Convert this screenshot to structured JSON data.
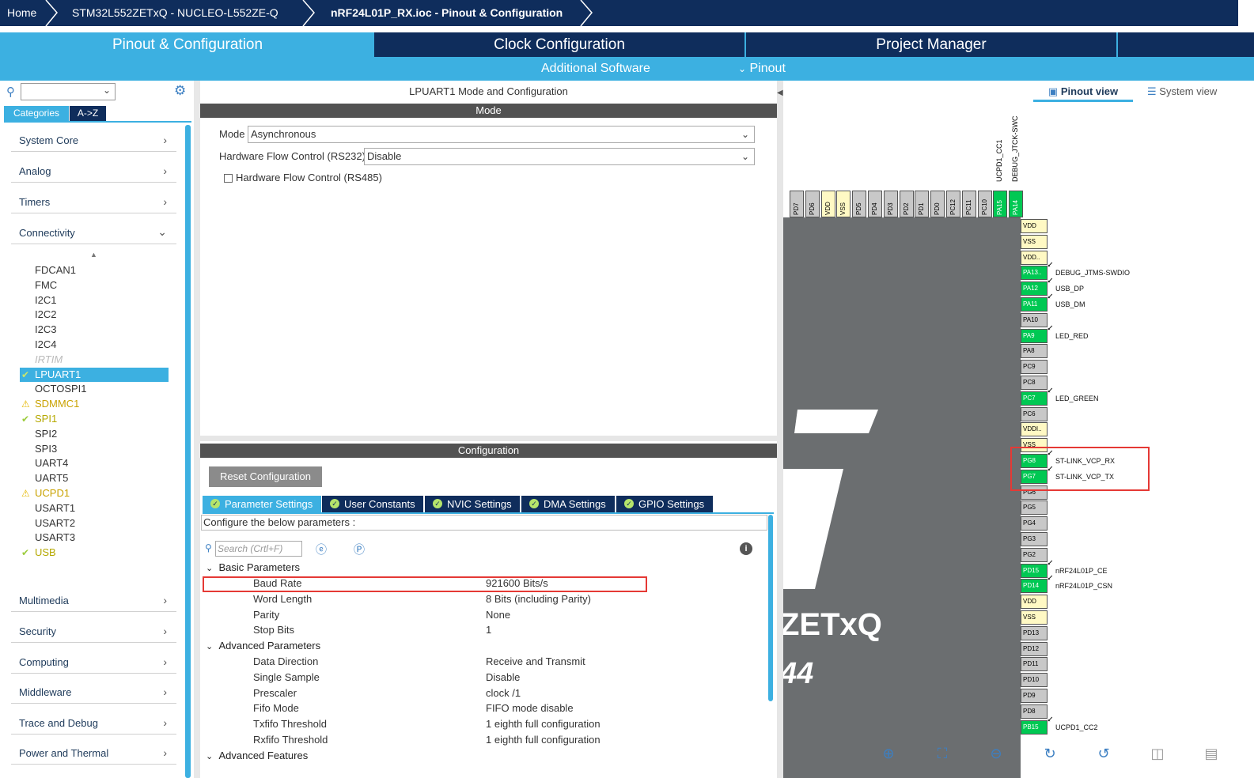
{
  "breadcrumb": {
    "home": "Home",
    "board": "STM32L552ZETxQ  -  NUCLEO-L552ZE-Q",
    "file": "nRF24L01P_RX.ioc - Pinout & Configuration"
  },
  "tabs": {
    "pinout": "Pinout & Configuration",
    "clock": "Clock Configuration",
    "project": "Project Manager",
    "additional": "Additional Software",
    "pinout_menu": "Pinout"
  },
  "sidebar": {
    "search_value": "",
    "tab_categories": "Categories",
    "tab_az": "A->Z",
    "categories": [
      "System Core",
      "Analog",
      "Timers",
      "Connectivity"
    ],
    "connectivity_items": [
      {
        "label": "FDCAN1",
        "mark": ""
      },
      {
        "label": "FMC",
        "mark": ""
      },
      {
        "label": "I2C1",
        "mark": ""
      },
      {
        "label": "I2C2",
        "mark": ""
      },
      {
        "label": "I2C3",
        "mark": ""
      },
      {
        "label": "I2C4",
        "mark": ""
      },
      {
        "label": "IRTIM",
        "mark": "disabled"
      },
      {
        "label": "LPUART1",
        "mark": "check-selected"
      },
      {
        "label": "OCTOSPI1",
        "mark": ""
      },
      {
        "label": "SDMMC1",
        "mark": "warning"
      },
      {
        "label": "SPI1",
        "mark": "check"
      },
      {
        "label": "SPI2",
        "mark": ""
      },
      {
        "label": "SPI3",
        "mark": ""
      },
      {
        "label": "UART4",
        "mark": ""
      },
      {
        "label": "UART5",
        "mark": ""
      },
      {
        "label": "UCPD1",
        "mark": "warning"
      },
      {
        "label": "USART1",
        "mark": ""
      },
      {
        "label": "USART2",
        "mark": ""
      },
      {
        "label": "USART3",
        "mark": ""
      },
      {
        "label": "USB",
        "mark": "check"
      }
    ],
    "lower_categories": [
      "Multimedia",
      "Security",
      "Computing",
      "Middleware",
      "Trace and Debug",
      "Power and Thermal"
    ]
  },
  "mode_panel": {
    "title": "LPUART1 Mode and Configuration",
    "section": "Mode",
    "mode_label": "Mode",
    "mode_value": "Asynchronous",
    "hwfc_label": "Hardware Flow Control (RS232)",
    "hwfc_value": "Disable",
    "rs485_label": "Hardware Flow Control (RS485)"
  },
  "config_panel": {
    "section": "Configuration",
    "reset_button": "Reset Configuration",
    "tabs": [
      "Parameter Settings",
      "User Constants",
      "NVIC Settings",
      "DMA Settings",
      "GPIO Settings"
    ],
    "hint": "Configure the below parameters :",
    "search_placeholder": "Search (Crtl+F)",
    "groups": {
      "basic": "Basic Parameters",
      "advanced": "Advanced Parameters",
      "features": "Advanced Features"
    },
    "basic_params": [
      {
        "name": "Baud Rate",
        "value": "921600 Bits/s"
      },
      {
        "name": "Word Length",
        "value": "8 Bits (including Parity)"
      },
      {
        "name": "Parity",
        "value": "None"
      },
      {
        "name": "Stop Bits",
        "value": "1"
      }
    ],
    "advanced_params": [
      {
        "name": "Data Direction",
        "value": "Receive and Transmit"
      },
      {
        "name": "Single Sample",
        "value": "Disable"
      },
      {
        "name": "Prescaler",
        "value": "clock /1"
      },
      {
        "name": "Fifo Mode",
        "value": "FIFO mode disable"
      },
      {
        "name": "Txfifo Threshold",
        "value": "1 eighth full configuration"
      },
      {
        "name": "Rxfifo Threshold",
        "value": "1 eighth full configuration"
      }
    ]
  },
  "pinout": {
    "pinout_view": "Pinout view",
    "system_view": "System view",
    "chip_text": "ZETxQ",
    "chip_pkg": "44",
    "top_pins": [
      "PD7",
      "PD6",
      "VDD",
      "VSS",
      "PD5",
      "PD4",
      "PD3",
      "PD2",
      "PD1",
      "PD0",
      "PC12",
      "PC11",
      "PC10",
      "PA15",
      "PA14"
    ],
    "top_signals": [
      "UCPD1_CC1",
      "DEBUG_JTCK-SWC"
    ],
    "right_pins": [
      {
        "pin": "VDD",
        "type": "y",
        "signal": ""
      },
      {
        "pin": "VSS",
        "type": "y",
        "signal": ""
      },
      {
        "pin": "VDD..",
        "type": "y",
        "signal": ""
      },
      {
        "pin": "PA13..",
        "type": "g",
        "signal": "DEBUG_JTMS-SWDIO"
      },
      {
        "pin": "PA12",
        "type": "g",
        "signal": "USB_DP"
      },
      {
        "pin": "PA11",
        "type": "g",
        "signal": "USB_DM"
      },
      {
        "pin": "PA10",
        "type": "",
        "signal": ""
      },
      {
        "pin": "PA9",
        "type": "g",
        "signal": "LED_RED"
      },
      {
        "pin": "PA8",
        "type": "",
        "signal": ""
      },
      {
        "pin": "PC9",
        "type": "",
        "signal": ""
      },
      {
        "pin": "PC8",
        "type": "",
        "signal": ""
      },
      {
        "pin": "PC7",
        "type": "g",
        "signal": "LED_GREEN"
      },
      {
        "pin": "PC6",
        "type": "",
        "signal": ""
      },
      {
        "pin": "VDDI..",
        "type": "y",
        "signal": ""
      },
      {
        "pin": "VSS",
        "type": "y",
        "signal": ""
      },
      {
        "pin": "PG8",
        "type": "g",
        "signal": "ST-LINK_VCP_RX"
      },
      {
        "pin": "PG7",
        "type": "g",
        "signal": "ST-LINK_VCP_TX"
      },
      {
        "pin": "PG6",
        "type": "",
        "signal": ""
      },
      {
        "pin": "PG5",
        "type": "",
        "signal": ""
      },
      {
        "pin": "PG4",
        "type": "",
        "signal": ""
      },
      {
        "pin": "PG3",
        "type": "",
        "signal": ""
      },
      {
        "pin": "PG2",
        "type": "",
        "signal": ""
      },
      {
        "pin": "PD15",
        "type": "g",
        "signal": "nRF24L01P_CE"
      },
      {
        "pin": "PD14",
        "type": "g",
        "signal": "nRF24L01P_CSN"
      },
      {
        "pin": "VDD",
        "type": "y",
        "signal": ""
      },
      {
        "pin": "VSS",
        "type": "y",
        "signal": ""
      },
      {
        "pin": "PD13",
        "type": "",
        "signal": ""
      },
      {
        "pin": "PD12",
        "type": "",
        "signal": ""
      },
      {
        "pin": "PD11",
        "type": "",
        "signal": ""
      },
      {
        "pin": "PD10",
        "type": "",
        "signal": ""
      },
      {
        "pin": "PD9",
        "type": "",
        "signal": ""
      },
      {
        "pin": "PD8",
        "type": "",
        "signal": ""
      },
      {
        "pin": "PB15",
        "type": "g",
        "signal": "UCPD1_CC2"
      }
    ]
  },
  "colors": {
    "navy": "#0f2d5c",
    "accent_blue": "#3cb0e1",
    "pin_green": "#00c853",
    "highlight_red": "#e53935"
  }
}
